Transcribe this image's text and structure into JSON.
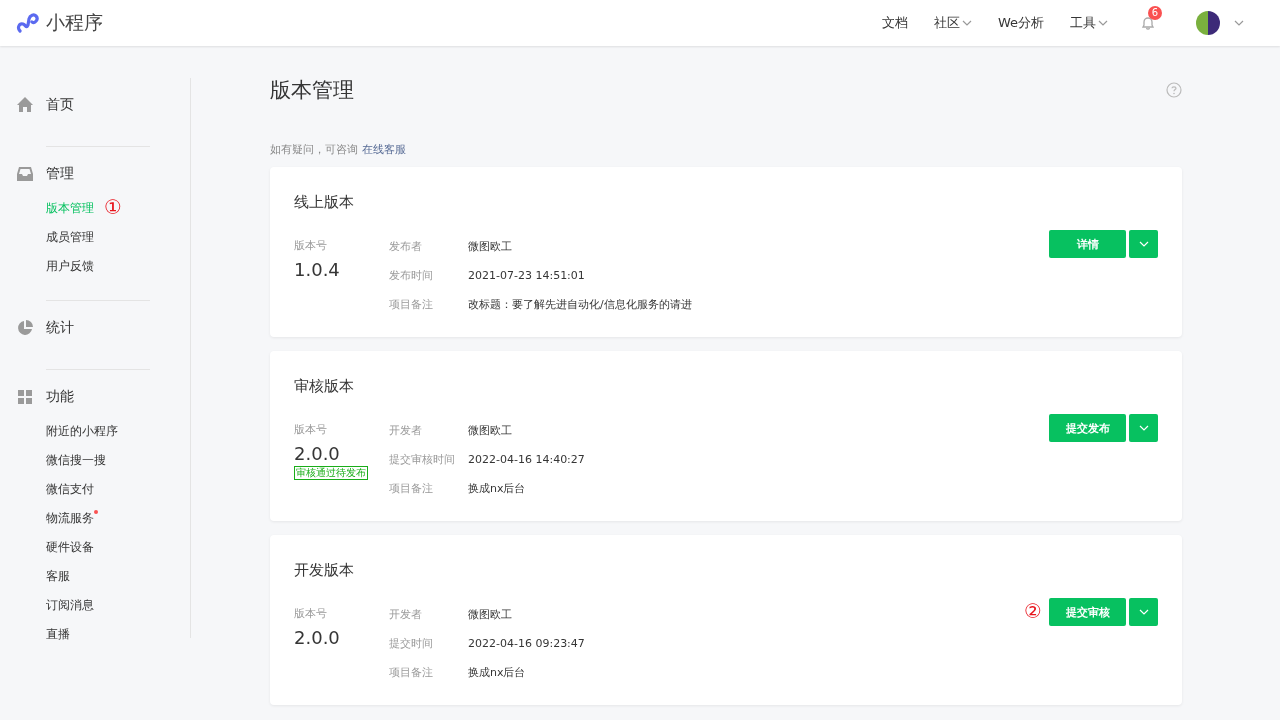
{
  "header": {
    "brand": "小程序",
    "nav": [
      {
        "label": "文档",
        "dropdown": false
      },
      {
        "label": "社区",
        "dropdown": true
      },
      {
        "label": "We分析",
        "dropdown": false
      },
      {
        "label": "工具",
        "dropdown": true
      }
    ],
    "notification_count": "6"
  },
  "sidebar": {
    "sections": [
      {
        "title": "首页"
      },
      {
        "title": "管理",
        "items": [
          {
            "label": "版本管理",
            "selected": true,
            "dot": false,
            "annotation": "①"
          },
          {
            "label": "成员管理",
            "selected": false,
            "dot": false
          },
          {
            "label": "用户反馈",
            "selected": false,
            "dot": false
          }
        ]
      },
      {
        "title": "统计"
      },
      {
        "title": "功能",
        "items": [
          {
            "label": "附近的小程序",
            "selected": false,
            "dot": false
          },
          {
            "label": "微信搜一搜",
            "selected": false,
            "dot": false
          },
          {
            "label": "微信支付",
            "selected": false,
            "dot": false
          },
          {
            "label": "物流服务",
            "selected": false,
            "dot": true
          },
          {
            "label": "硬件设备",
            "selected": false,
            "dot": false
          },
          {
            "label": "客服",
            "selected": false,
            "dot": false
          },
          {
            "label": "订阅消息",
            "selected": false,
            "dot": false
          },
          {
            "label": "直播",
            "selected": false,
            "dot": false
          }
        ]
      }
    ]
  },
  "page": {
    "title": "版本管理",
    "help_text": "如有疑问，可咨询",
    "help_link": "在线客服"
  },
  "cards": [
    {
      "title": "线上版本",
      "version_label": "版本号",
      "version": "1.0.4",
      "fields": [
        {
          "label": "发布者",
          "value": "微图欧工"
        },
        {
          "label": "发布时间",
          "value": "2021-07-23 14:51:01"
        },
        {
          "label": "项目备注",
          "value": "改标题：要了解先进自动化/信息化服务的请进"
        }
      ],
      "button": "详情"
    },
    {
      "title": "审核版本",
      "version_label": "版本号",
      "version": "2.0.0",
      "badge": "审核通过待发布",
      "fields": [
        {
          "label": "开发者",
          "value": "微图欧工"
        },
        {
          "label": "提交审核时间",
          "value": "2022-04-16 14:40:27"
        },
        {
          "label": "项目备注",
          "value": "换成nx后台"
        }
      ],
      "button": "提交发布"
    },
    {
      "title": "开发版本",
      "version_label": "版本号",
      "version": "2.0.0",
      "fields": [
        {
          "label": "开发者",
          "value": "微图欧工"
        },
        {
          "label": "提交时间",
          "value": "2022-04-16 09:23:47"
        },
        {
          "label": "项目备注",
          "value": "换成nx后台"
        }
      ],
      "button": "提交审核",
      "annotation": "②"
    }
  ]
}
